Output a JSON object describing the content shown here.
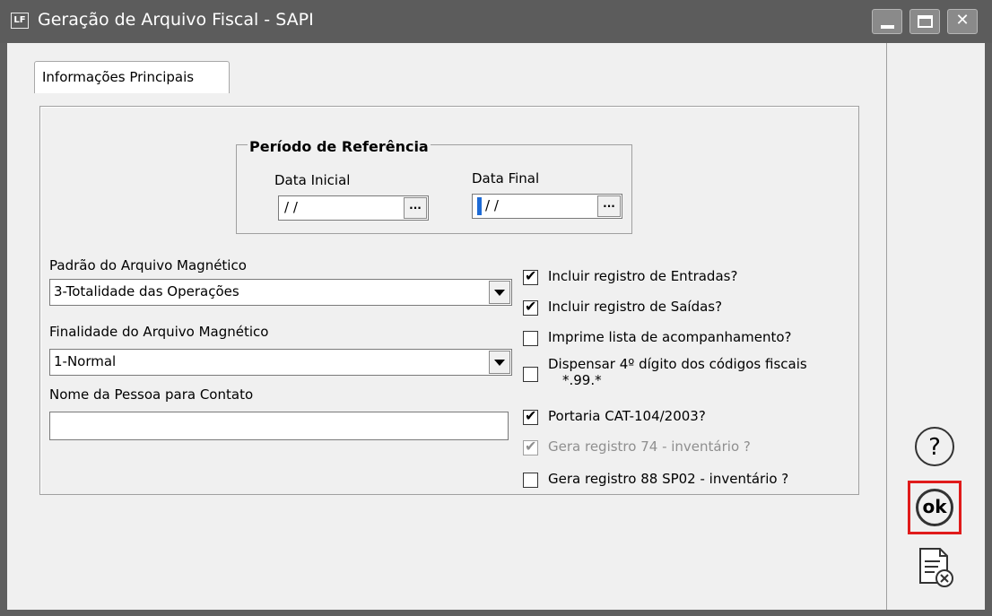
{
  "window": {
    "title": "Geração de Arquivo Fiscal - SAPI",
    "app_icon": "LF"
  },
  "tabs": [
    {
      "label": "Informações Principais"
    }
  ],
  "periodo": {
    "legend": "Período de Referência",
    "data_inicial": {
      "label": "Data Inicial",
      "value": "/ /"
    },
    "data_final": {
      "label": "Data Final",
      "value": "/ /"
    },
    "ellipsis": "..."
  },
  "padrao": {
    "label": "Padrão do Arquivo Magnético",
    "value": "3-Totalidade das Operações"
  },
  "finalidade": {
    "label": "Finalidade do Arquivo Magnético",
    "value": "1-Normal"
  },
  "contato": {
    "label": "Nome da Pessoa para Contato",
    "value": ""
  },
  "checkboxes": [
    {
      "label": "Incluir registro de Entradas?",
      "checked": true,
      "enabled": true
    },
    {
      "label": "Incluir registro de Saídas?",
      "checked": true,
      "enabled": true
    },
    {
      "label": "Imprime lista de acompanhamento?",
      "checked": false,
      "enabled": true
    },
    {
      "label": "Dispensar 4º dígito dos códigos fiscais",
      "sublabel": "*.99.*",
      "checked": false,
      "enabled": true
    },
    {
      "label": "Portaria CAT-104/2003?",
      "checked": true,
      "enabled": true
    },
    {
      "label": "Gera registro 74 - inventário ?",
      "checked": true,
      "enabled": false
    },
    {
      "label": "Gera registro 88 SP02 - inventário ?",
      "checked": false,
      "enabled": true
    }
  ],
  "side": {
    "help": "?",
    "ok": "ok"
  },
  "colors": {
    "titlebar": "#5c5c5c",
    "highlight": "#e01b1b"
  }
}
